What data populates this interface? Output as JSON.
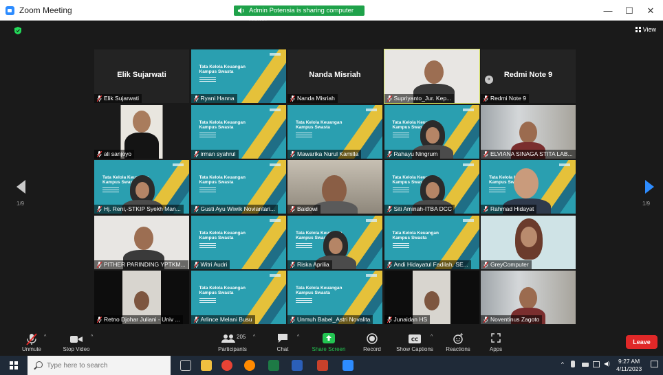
{
  "window": {
    "title": "Zoom Meeting",
    "share_banner": "Admin Potensia is sharing computer sound",
    "minimize": "—",
    "maximize": "☐",
    "close": "✕"
  },
  "meeting": {
    "view_label": "View",
    "page_left": "1/9",
    "page_right": "1/9",
    "badge": "«"
  },
  "participants": [
    {
      "name": "Elik Sujarwati",
      "center": "Elik Sujarwati",
      "kind": "blank"
    },
    {
      "name": "Ryani Hanna",
      "kind": "slide"
    },
    {
      "name": "Nanda Misriah",
      "center": "Nanda Misriah",
      "kind": "blank"
    },
    {
      "name": "Supriyanto_Jur. Kep...",
      "kind": "cam-light"
    },
    {
      "name": "Redmi Note 9",
      "center": "Redmi Note 9",
      "kind": "blank"
    },
    {
      "name": "ali sanjoyo",
      "kind": "cam-person"
    },
    {
      "name": "irman syahrul",
      "kind": "slide"
    },
    {
      "name": "Mawarika Nurul Kamilla",
      "kind": "slide"
    },
    {
      "name": "Rahayu Ningrum",
      "kind": "slide-hijab"
    },
    {
      "name": "ELVIANA SINAGA STITA LAB...",
      "kind": "cam-window"
    },
    {
      "name": "Hj. Reni,-STKIP Syekh Man...",
      "kind": "slide-hijab"
    },
    {
      "name": "Gusti Ayu Wiwik Noviantari...",
      "kind": "slide"
    },
    {
      "name": "Baidowi",
      "kind": "cam-room"
    },
    {
      "name": "Siti Aminah-ITBA DCC",
      "kind": "slide-hijab"
    },
    {
      "name": "Rahmad Hidayat",
      "kind": "slide-person"
    },
    {
      "name": "PITHER PARINDING YPTKM...",
      "kind": "cam-light"
    },
    {
      "name": "Witri Audri",
      "kind": "slide"
    },
    {
      "name": "Riska Aprilia",
      "kind": "slide-hijab"
    },
    {
      "name": "Andi Hidayatul Fadilah, SE...",
      "kind": "slide"
    },
    {
      "name": "GreyComputer",
      "kind": "cam-hijab"
    },
    {
      "name": "Retno Djohar Juliani - Univ ...",
      "kind": "cam-dark"
    },
    {
      "name": "Arlince Melani Busu",
      "kind": "slide"
    },
    {
      "name": "Unmuh Babel_Astri Novalita",
      "kind": "slide"
    },
    {
      "name": "Junaidan HS",
      "kind": "cam-dark"
    },
    {
      "name": "Noventinus Zagoto",
      "kind": "cam-window"
    }
  ],
  "slide_text": {
    "title_line1": "Tata Kelola Keuangan",
    "title_line2": "Kampus Swasta"
  },
  "toolbar": {
    "unmute": "Unmute",
    "stop_video": "Stop Video",
    "participants": "Participants",
    "participant_count": "205",
    "chat": "Chat",
    "share_screen": "Share Screen",
    "record": "Record",
    "show_captions": "Show Captions",
    "reactions": "Reactions",
    "apps": "Apps",
    "leave": "Leave"
  },
  "taskbar": {
    "search_placeholder": "Type here to search",
    "time": "9:27 AM",
    "date": "4/11/2023"
  },
  "colors": {
    "zoom_blue": "#2d8cff",
    "share_green": "#1fa24a",
    "leave_red": "#e02828",
    "slide_teal": "#2a9fb0",
    "highlight": "#d7e35a"
  }
}
